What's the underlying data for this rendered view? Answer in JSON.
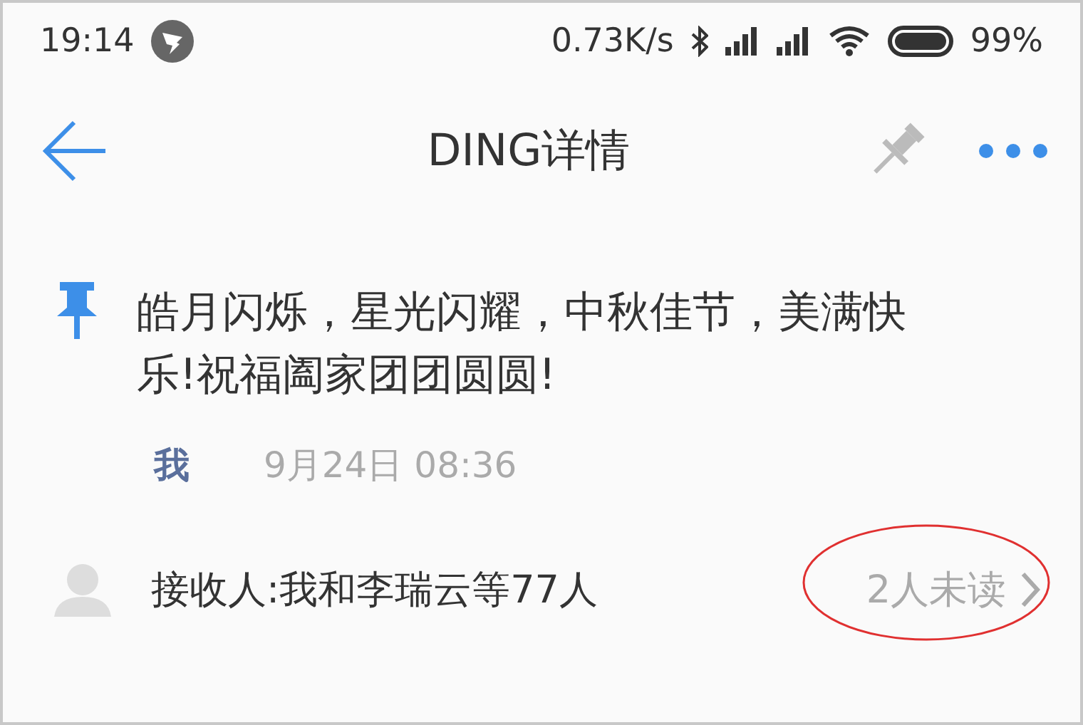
{
  "status_bar": {
    "time": "19:14",
    "speed": "0.73K/s",
    "battery": "99%"
  },
  "header": {
    "title": "DING详情"
  },
  "message": {
    "text": "皓月闪烁，星光闪耀，中秋佳节，美满快乐!祝福阖家团团圆圆!",
    "sender": "我",
    "time": "9月24日 08:36"
  },
  "recipients": {
    "label": "接收人:我和李瑞云等77人",
    "unread": "2人未读"
  }
}
